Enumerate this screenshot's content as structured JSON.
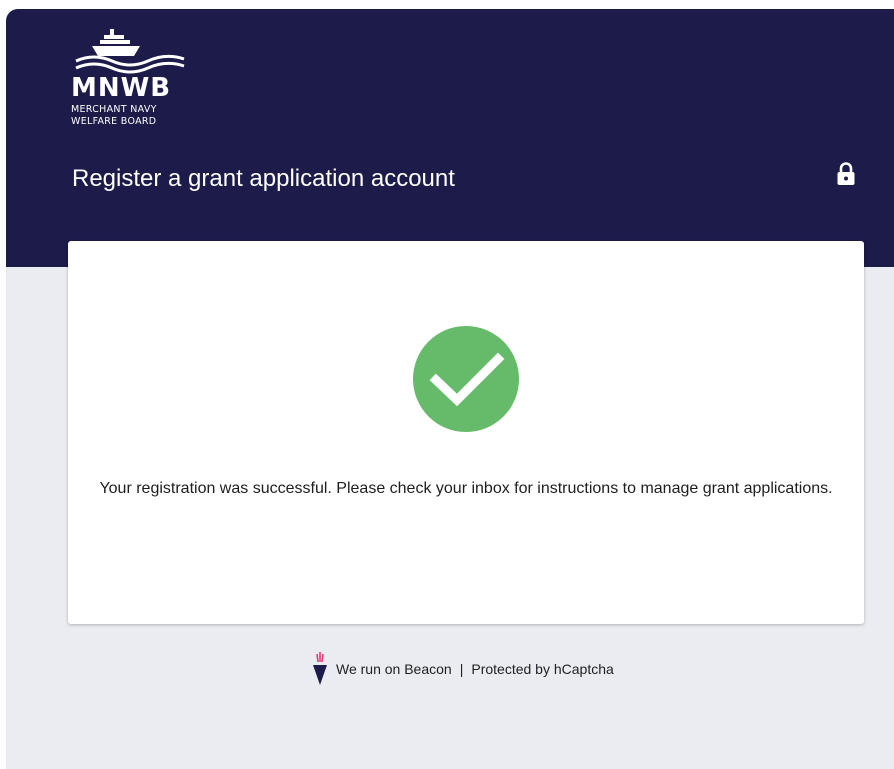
{
  "header": {
    "logo": {
      "abbreviation": "MNWB",
      "line1": "MERCHANT NAVY",
      "line2": "WELFARE BOARD",
      "icon": "ship-on-waves-icon"
    },
    "title": "Register a grant application account",
    "lock_icon": "lock-icon"
  },
  "card": {
    "status_icon": "check-circle-icon",
    "status_color": "#66bb6a",
    "message": "Your registration was successful. Please check your inbox for instructions to manage grant applications."
  },
  "footer": {
    "beacon_icon": "beacon-torch-icon",
    "beacon_text": "We run on Beacon",
    "separator": "|",
    "captcha_text": "Protected by hCaptcha"
  },
  "colors": {
    "header_bg": "#1d1b4a",
    "page_bg": "#ebecf1",
    "success": "#66bb6a"
  }
}
